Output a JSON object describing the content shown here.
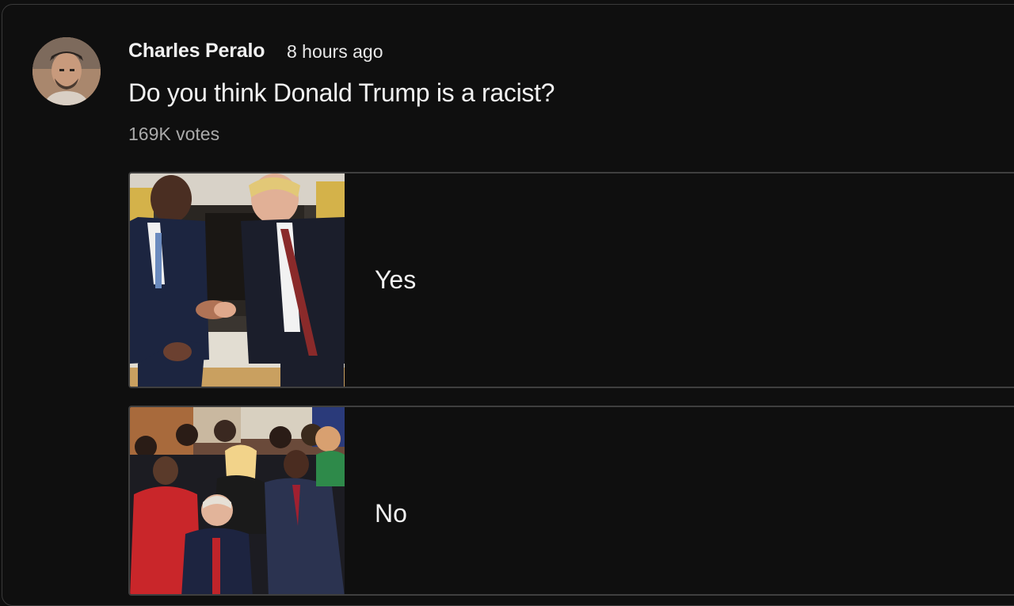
{
  "post": {
    "author": "Charles Peralo",
    "timestamp": "8 hours ago",
    "question": "Do you think Donald Trump is a racist?",
    "votes": "169K votes"
  },
  "options": [
    {
      "label": "Yes",
      "image": "handshake-photo"
    },
    {
      "label": "No",
      "image": "group-prayer-photo"
    }
  ],
  "icons": {
    "avatar": "author-avatar-photo"
  },
  "colors": {
    "background": "#0f0f0f",
    "border": "#3f3f3f",
    "text_primary": "#f1f1f1",
    "text_secondary": "#aaaaaa"
  }
}
